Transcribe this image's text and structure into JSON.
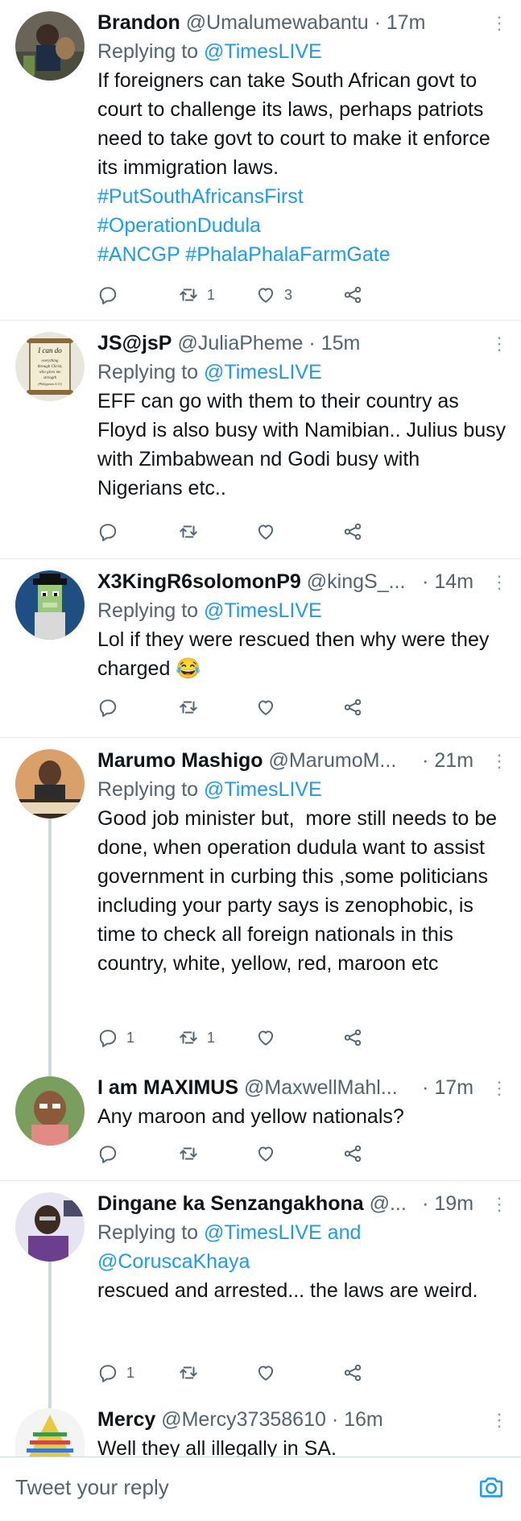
{
  "tweets": [
    {
      "name": "Brandon",
      "handle": "@Umalumewabantu",
      "time": "17m",
      "reply_prefix": "Replying to",
      "reply_to": "@TimesLIVE",
      "text": "If foreigners can take South African govt to court to challenge its laws, perhaps patriots need to take govt to court to make it enforce its immigration laws.",
      "hashtags_line1": "#PutSouthAfricansFirst",
      "hashtags_line2": "#OperationDudula",
      "hashtags_line3": "#ANCGP #PhalaPhalaFarmGate",
      "reply_count": "",
      "retweet_count": "1",
      "like_count": "3",
      "avatar_icon": "avatar-photo"
    },
    {
      "name": "JS@jsP",
      "handle": "@JuliaPheme",
      "time": "15m",
      "reply_prefix": "Replying to",
      "reply_to": "@TimesLIVE",
      "text": "EFF can go with them to their country as Floyd is also busy with Namibian.. Julius busy with Zimbabwean nd Godi busy with Nigerians etc..",
      "reply_count": "",
      "retweet_count": "",
      "like_count": "",
      "avatar_lines": [
        "I can do",
        "everything",
        "through Christ,",
        "who gives me",
        "strength",
        "(Philippians 4:13)"
      ]
    },
    {
      "name": "X3KingR6solomonP9",
      "handle": "@kingS_...",
      "time": "14m",
      "reply_prefix": "Replying to",
      "reply_to": "@TimesLIVE",
      "text": "Lol if they were rescued then why were they charged 😂",
      "reply_count": "",
      "retweet_count": "",
      "like_count": ""
    },
    {
      "name": "Marumo Mashigo",
      "handle": "@MarumoM...",
      "time": "21m",
      "reply_prefix": "Replying to",
      "reply_to": "@TimesLIVE",
      "text": "Good job minister but,  more still needs to be done, when operation dudula want to assist government in curbing this ,some politicians including your party says is zenophobic, is time to check all foreign nationals in this country, white, yellow, red, maroon etc",
      "reply_count": "1",
      "retweet_count": "1",
      "like_count": ""
    },
    {
      "name": "I am MAXIMUS",
      "handle": "@MaxwellMahl...",
      "time": "17m",
      "text": "Any maroon and yellow nationals?",
      "reply_count": "",
      "retweet_count": "",
      "like_count": ""
    },
    {
      "name": "Dingane ka Senzangakhona",
      "handle": "@...",
      "time": "19m",
      "reply_prefix": "Replying to",
      "reply_to": "@TimesLIVE and",
      "reply_to2": "@CoruscaKhaya",
      "text": "rescued and arrested... the laws are weird.",
      "reply_count": "1",
      "retweet_count": "",
      "like_count": ""
    },
    {
      "name": "Mercy",
      "handle": "@Mercy37358610",
      "time": "16m",
      "text": "Well they all illegally in SA."
    }
  ],
  "separator": "·",
  "reply_box": {
    "placeholder": "Tweet your reply"
  },
  "colors": {
    "accent": "#1d9bf0",
    "muted": "#536471",
    "text": "#0f1419",
    "divider": "#e6ecf0",
    "thread_line": "#cfd9de"
  }
}
